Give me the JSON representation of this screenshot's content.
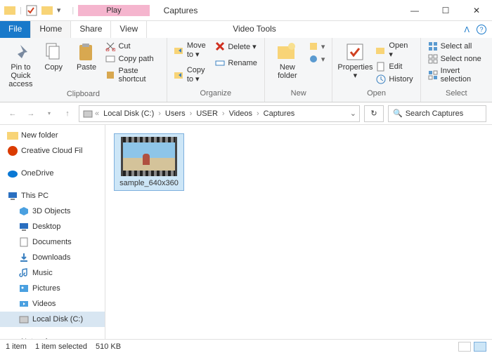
{
  "titlebar": {
    "play": "Play",
    "title": "Captures",
    "min": "—",
    "max": "☐",
    "close": "✕"
  },
  "tabs": {
    "file": "File",
    "home": "Home",
    "share": "Share",
    "view": "View",
    "video_tools": "Video Tools",
    "expand": "ᐱ",
    "help": "?"
  },
  "ribbon": {
    "clipboard": {
      "label": "Clipboard",
      "pin": "Pin to Quick access",
      "copy": "Copy",
      "paste": "Paste",
      "cut": "Cut",
      "copy_path": "Copy path",
      "paste_shortcut": "Paste shortcut"
    },
    "organize": {
      "label": "Organize",
      "move": "Move to ▾",
      "copy": "Copy to ▾",
      "delete": "Delete ▾",
      "rename": "Rename"
    },
    "new": {
      "label": "New",
      "folder": "New folder"
    },
    "open": {
      "label": "Open",
      "properties": "Properties",
      "open": "Open ▾",
      "edit": "Edit",
      "history": "History"
    },
    "select": {
      "label": "Select",
      "all": "Select all",
      "none": "Select none",
      "invert": "Invert selection"
    }
  },
  "address": {
    "crumbs": [
      "Local Disk (C:)",
      "Users",
      "USER",
      "Videos",
      "Captures"
    ],
    "search_placeholder": "Search Captures"
  },
  "sidebar": {
    "items": [
      {
        "label": "New folder",
        "icon": "folder",
        "indent": 1
      },
      {
        "label": "Creative Cloud Fil",
        "icon": "cc",
        "indent": 1
      },
      {
        "label": "OneDrive",
        "icon": "onedrive",
        "indent": 1,
        "gap": true
      },
      {
        "label": "This PC",
        "icon": "pc",
        "indent": 1,
        "gap": true
      },
      {
        "label": "3D Objects",
        "icon": "3d",
        "indent": 2
      },
      {
        "label": "Desktop",
        "icon": "desktop",
        "indent": 2
      },
      {
        "label": "Documents",
        "icon": "docs",
        "indent": 2
      },
      {
        "label": "Downloads",
        "icon": "downloads",
        "indent": 2
      },
      {
        "label": "Music",
        "icon": "music",
        "indent": 2
      },
      {
        "label": "Pictures",
        "icon": "pictures",
        "indent": 2
      },
      {
        "label": "Videos",
        "icon": "videos",
        "indent": 2
      },
      {
        "label": "Local Disk (C:)",
        "icon": "disk",
        "indent": 2,
        "selected": true
      },
      {
        "label": "Network",
        "icon": "network",
        "indent": 1,
        "gap": true
      }
    ]
  },
  "content": {
    "file_name": "sample_640x360"
  },
  "status": {
    "items": "1 item",
    "selected": "1 item selected",
    "size": "510 KB"
  }
}
